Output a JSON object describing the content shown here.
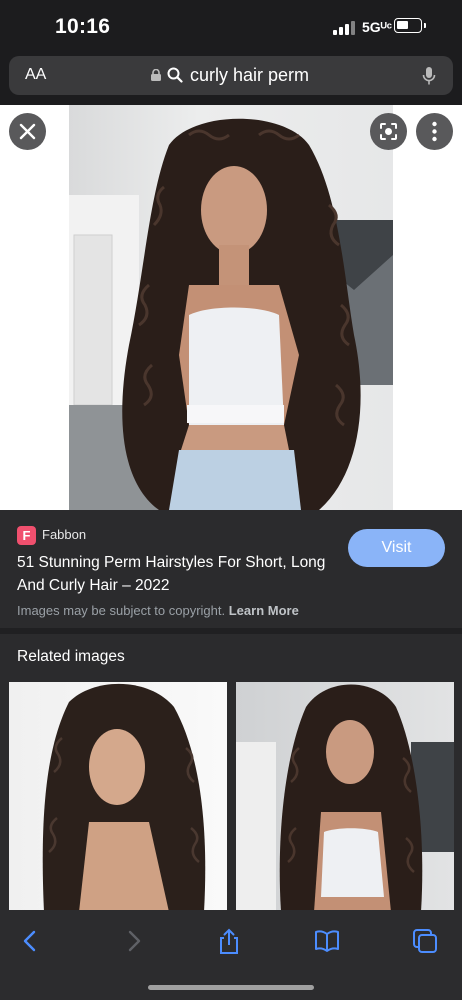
{
  "status_bar": {
    "time": "10:16",
    "network": "5Gᵁᶜ"
  },
  "address_bar": {
    "aa_label": "AA",
    "query": "curly hair perm"
  },
  "result": {
    "source": "Fabbon",
    "favicon_letter": "F",
    "title": "51 Stunning Perm Hairstyles For Short, Long And Curly Hair – 2022",
    "visit_label": "Visit",
    "copyright_text": "Images may be subject to copyright.",
    "learn_more": "Learn More"
  },
  "related": {
    "title": "Related images"
  },
  "icons": {
    "close": "close-icon",
    "lens": "lens-icon",
    "more": "more-icon",
    "back": "back-icon",
    "forward": "forward-icon",
    "share": "share-icon",
    "bookmarks": "bookmarks-icon",
    "tabs": "tabs-icon"
  },
  "colors": {
    "accent": "#8ab4f8",
    "favicon": "#f0506e",
    "panel": "#2b2b2d"
  }
}
